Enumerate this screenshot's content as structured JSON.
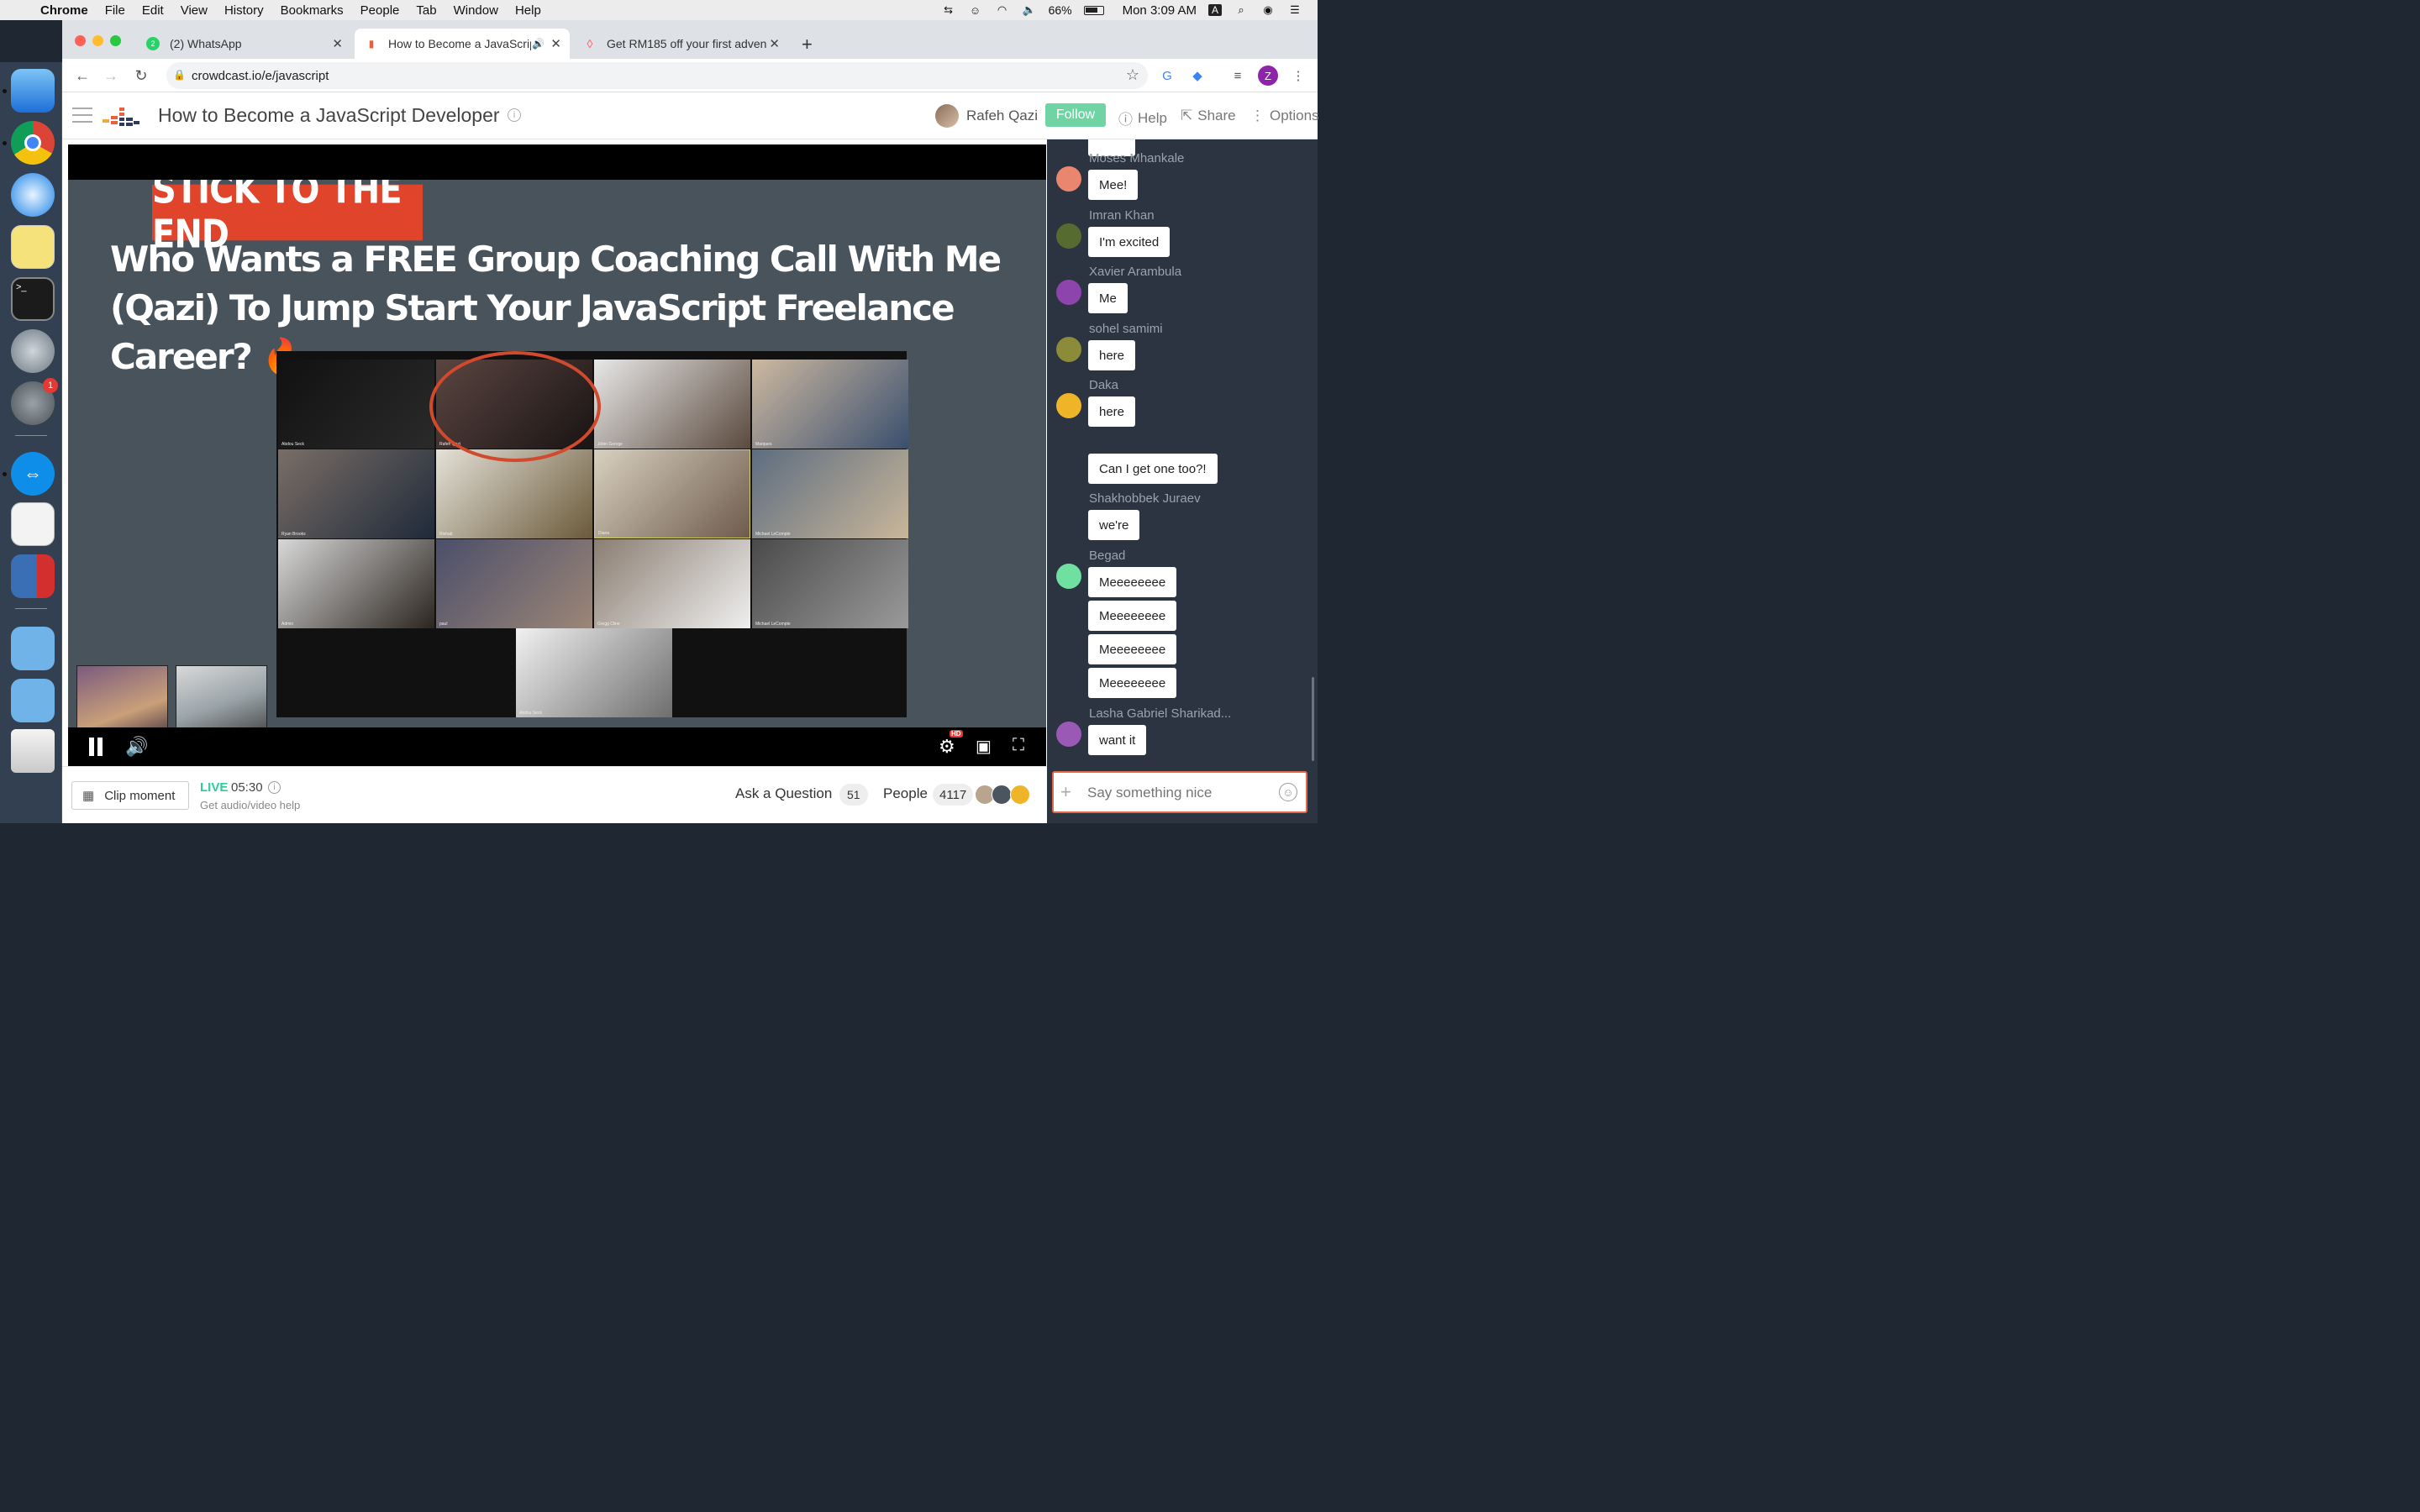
{
  "menubar": {
    "app_name": "Chrome",
    "menus": [
      "File",
      "Edit",
      "View",
      "History",
      "Bookmarks",
      "People",
      "Tab",
      "Window",
      "Help"
    ],
    "battery": "66%",
    "clock": "Mon 3:09 AM",
    "input_source": "A"
  },
  "dock": {
    "settings_badge": "1"
  },
  "browser": {
    "tabs": [
      {
        "title": "(2) WhatsApp",
        "favicon_badge": "2"
      },
      {
        "title": "How to Become a JavaScrip",
        "active": true
      },
      {
        "title": "Get RM185 off your first adven"
      }
    ],
    "url": "crowdcast.io/e/javascript",
    "profile_initial": "Z"
  },
  "header": {
    "event_title": "How to Become a JavaScript Developer",
    "host_name": "Rafeh Qazi",
    "follow_label": "Follow",
    "help_label": "Help",
    "share_label": "Share",
    "options_label": "Options"
  },
  "slide": {
    "badge": "STICK TO THE END",
    "headline": "Who Wants a FREE Group Coaching Call With Me (Qazi) To Jump Start Your JavaScript Freelance Career? 🔥",
    "participants": [
      "Abdou Seck",
      "Rafeh Qazi",
      "Jobin George",
      "Marques",
      "Ryan Brooks",
      "Rishab",
      "Diana",
      "Michael LeCompte",
      "Admin",
      "paul",
      "Gregg Cline",
      "Michael LeCompte",
      "Abdou Seck"
    ]
  },
  "player": {
    "hd_badge": "HD"
  },
  "bottom": {
    "clip_label": "Clip moment",
    "live_label": "LIVE",
    "live_time": "05:30",
    "av_help": "Get audio/video help",
    "ask_label": "Ask a Question",
    "ask_count": "51",
    "people_label": "People",
    "people_count": "4117"
  },
  "chat": {
    "messages": [
      {
        "user": "Moses Mhankale",
        "text": "Mee!",
        "avatar_color": "#e8866f"
      },
      {
        "user": "Imran Khan",
        "text": "I'm excited",
        "avatar_color": "#556b2f"
      },
      {
        "user": "Xavier Arambula",
        "text": "Me",
        "avatar_color": "#8e44ad"
      },
      {
        "user": "sohel samimi",
        "text": "here",
        "avatar_color": "#8b8b3a"
      },
      {
        "user": "Daka",
        "text": "here",
        "avatar_color": "#f0b429"
      },
      {
        "user": "",
        "text": "Can I get one too?!",
        "avatar_color": ""
      },
      {
        "user": "Shakhobbek Juraev",
        "text": "we're",
        "avatar_color": ""
      },
      {
        "user": "Begad",
        "texts": [
          "Meeeeeeee",
          "Meeeeeeee",
          "Meeeeeeee",
          "Meeeeeeee"
        ],
        "avatar_color": "#6fe0a0"
      },
      {
        "user": "Lasha Gabriel Sharikad...",
        "text": "want it",
        "avatar_color": "#9b59b6"
      }
    ],
    "input_placeholder": "Say something nice"
  }
}
